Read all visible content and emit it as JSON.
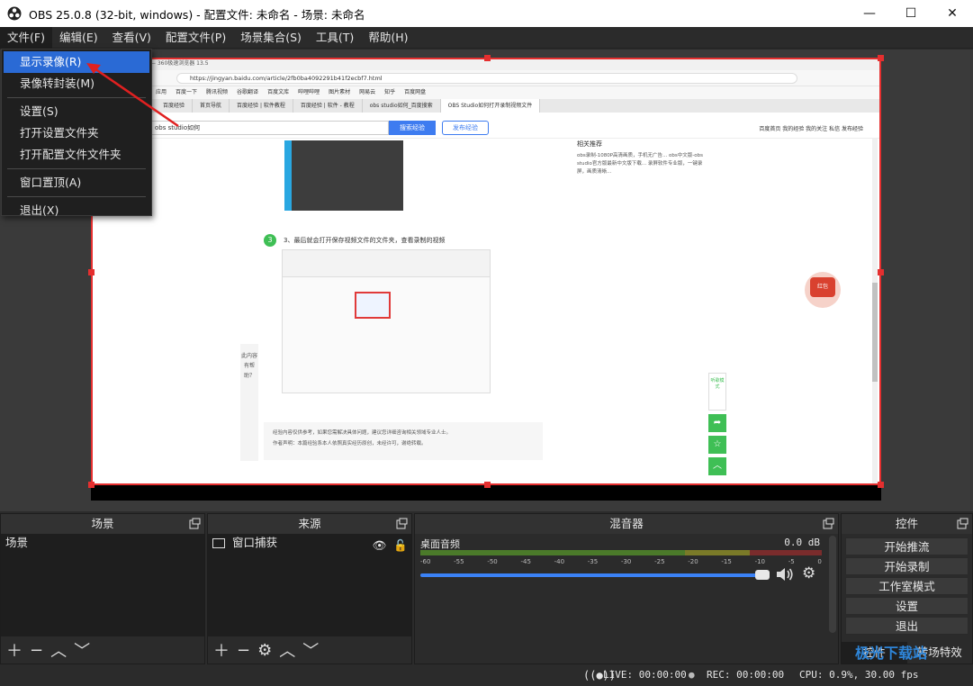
{
  "window": {
    "title": "OBS 25.0.8 (32-bit, windows) - 配置文件: 未命名 - 场景: 未命名",
    "min": "—",
    "max": "☐",
    "close": "✕"
  },
  "menubar": [
    "文件(F)",
    "编辑(E)",
    "查看(V)",
    "配置文件(P)",
    "场景集合(S)",
    "工具(T)",
    "帮助(H)"
  ],
  "file_menu": {
    "items": [
      "显示录像(R)",
      "录像转封装(M)",
      "设置(S)",
      "打开设置文件夹",
      "打开配置文件文件夹",
      "窗口置顶(A)",
      "退出(X)"
    ]
  },
  "capture": {
    "url": "https://jingyan.baidu.com/article/2fb0ba4092291b41f2ecbf7.html",
    "tab_active": "OBS Studio如何打开录制视频文件",
    "tabs": [
      "百度经验",
      "首页导航",
      "百度经验 | 软件教程",
      "百度经验 | 软件 - 教程",
      "obs studio如何_百度搜索",
      "OBS Studio如何打开录制视频文件"
    ],
    "bookmarks": [
      "应用",
      "百度一下",
      "腾讯视频",
      "谷歌翻译",
      "百度文库",
      "哔哩哔哩",
      "图片素材",
      "网易云",
      "知乎",
      "百度网盘"
    ],
    "search_query": "obs studio如何",
    "search_btn": "搜索经验",
    "publish_btn": "发布经验",
    "top_links": "百度首页   我的经验   我的关注   私信   发布经验",
    "step_number": "3",
    "step_text": "3、最后就会打开保存视频文件的文件夹，查看录制的视频",
    "right_panel_title": "相关推荐",
    "right_panel_text": "obs录制-1080P高清画质，手机无广告... obs中文版-obs studio官方版最新中文版下载... 录屏软件专业版，一键录屏，画质清晰...",
    "tip_text": "经验内容仅供参考，如果您需解决具体问题，建议您详细咨询相关领域专业人士。",
    "tip_text2": "作者声明：本篇经验系本人依照真实经历原创，未经许可，谢绝转载。",
    "vote_text": "此内容有帮助？",
    "redpack": "红包",
    "side_tool_label": "听歌模式"
  },
  "docks": {
    "scenes": {
      "title": "场景",
      "items": [
        "场景"
      ]
    },
    "sources": {
      "title": "来源",
      "items": [
        "窗口捕获"
      ]
    },
    "mixer": {
      "title": "混音器",
      "channel": "桌面音频",
      "db": "0.0 dB",
      "ticks": [
        "-60",
        "-55",
        "-50",
        "-45",
        "-40",
        "-35",
        "-30",
        "-25",
        "-20",
        "-15",
        "-10",
        "-5",
        "0"
      ]
    },
    "controls": {
      "title": "控件",
      "buttons": [
        "开始推流",
        "开始录制",
        "工作室模式",
        "设置",
        "退出"
      ],
      "tabs": [
        "控件",
        "转场特效"
      ]
    }
  },
  "status": {
    "live": "LIVE: 00:00:00",
    "rec": "REC: 00:00:00",
    "cpu": "CPU: 0.9%, 30.00 fps"
  },
  "watermark": "极光下载站",
  "colors": {
    "accent": "#2a6ad5",
    "selection": "#e52f2f",
    "volume": "#3b82f6"
  }
}
